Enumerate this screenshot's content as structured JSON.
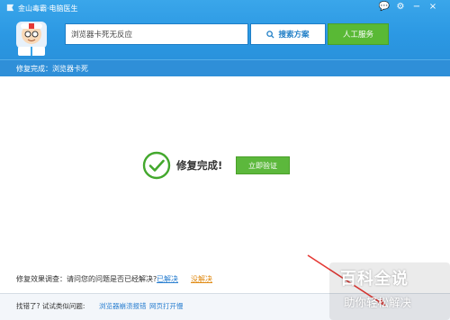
{
  "window": {
    "title": "金山毒霸·电脑医生",
    "controls": [
      "feedback-icon",
      "settings-icon",
      "minimize-icon",
      "close-icon"
    ]
  },
  "search": {
    "value": "浏览器卡死无反应",
    "button_label": "搜索方案"
  },
  "header": {
    "human_service_label": "人工服务"
  },
  "status": {
    "text": "修复完成：浏览器卡死"
  },
  "result": {
    "title": "修复完成!",
    "verify_label": "立即验证"
  },
  "feedback": {
    "prompt": "修复效果调查：请问您的问题是否已经解决?",
    "yes_label": "已解决",
    "no_label": "没解决"
  },
  "footer": {
    "label": "找错了? 试试类似问题:",
    "links": [
      "浏览器崩溃报错",
      "网页打开慢"
    ]
  },
  "watermark": {
    "line1": "百科全说",
    "line2": "助你轻松解决"
  },
  "colors": {
    "header_blue": "#2b98e3",
    "status_blue": "#2f8fd8",
    "green": "#5cb83c",
    "link_blue": "#2a7fd0",
    "link_orange": "#e08a12",
    "annotation_red": "#e53935"
  }
}
